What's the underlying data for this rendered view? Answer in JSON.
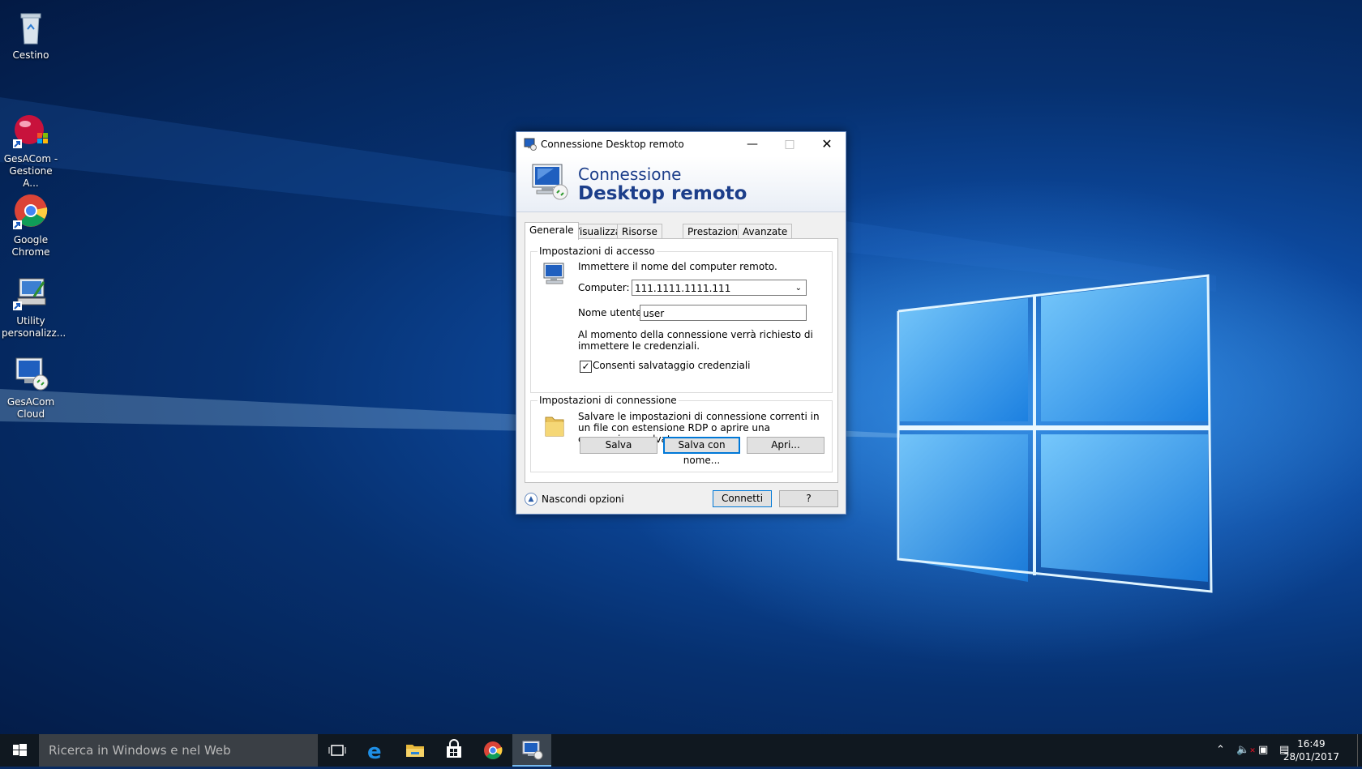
{
  "desktop": {
    "icons": [
      {
        "label": "Cestino",
        "icon": "recycle-bin-icon"
      },
      {
        "label": "GesACom -\nGestione A...",
        "icon": "gesacom-app-icon"
      },
      {
        "label": "Google\nChrome",
        "icon": "chrome-icon"
      },
      {
        "label": "Utility\npersonalizz...",
        "icon": "utility-icon"
      },
      {
        "label": "GesACom\nCloud",
        "icon": "remote-desktop-icon"
      }
    ]
  },
  "dialog": {
    "title": "Connessione Desktop remoto",
    "banner_line1": "Connessione",
    "banner_line2": "Desktop remoto",
    "tabs": [
      "Generale",
      "Visualizza",
      "Risorse locali",
      "Prestazioni",
      "Avanzate"
    ],
    "active_tab": "Generale",
    "access_group": {
      "legend": "Impostazioni di accesso",
      "intro": "Immettere il nome del computer remoto.",
      "computer_label": "Computer:",
      "computer_value": "111.1111.1111.111",
      "user_label": "Nome utente:",
      "user_value": "user",
      "note": "Al momento della connessione verrà richiesto di immettere le credenziali.",
      "save_credentials_label": "Consenti salvataggio credenziali",
      "save_credentials_checked": true
    },
    "connection_group": {
      "legend": "Impostazioni di connessione",
      "text": "Salvare le impostazioni di connessione correnti in un file con estensione RDP o aprire una connessione salvata.",
      "save_label": "Salva",
      "save_as_label": "Salva con nome...",
      "open_label": "Apri..."
    },
    "hide_options_label": "Nascondi opzioni",
    "connect_label": "Connetti",
    "help_label": "?"
  },
  "taskbar": {
    "search_placeholder": "Ricerca in Windows e nel Web",
    "time": "16:49",
    "date": "28/01/2017",
    "pinned": [
      "task-view-icon",
      "edge-icon",
      "file-explorer-icon",
      "store-icon",
      "chrome-icon",
      "remote-desktop-icon"
    ]
  },
  "colors": {
    "accent": "#0078d7",
    "banner_text": "#1c3e8a",
    "taskbar": "#101820"
  }
}
